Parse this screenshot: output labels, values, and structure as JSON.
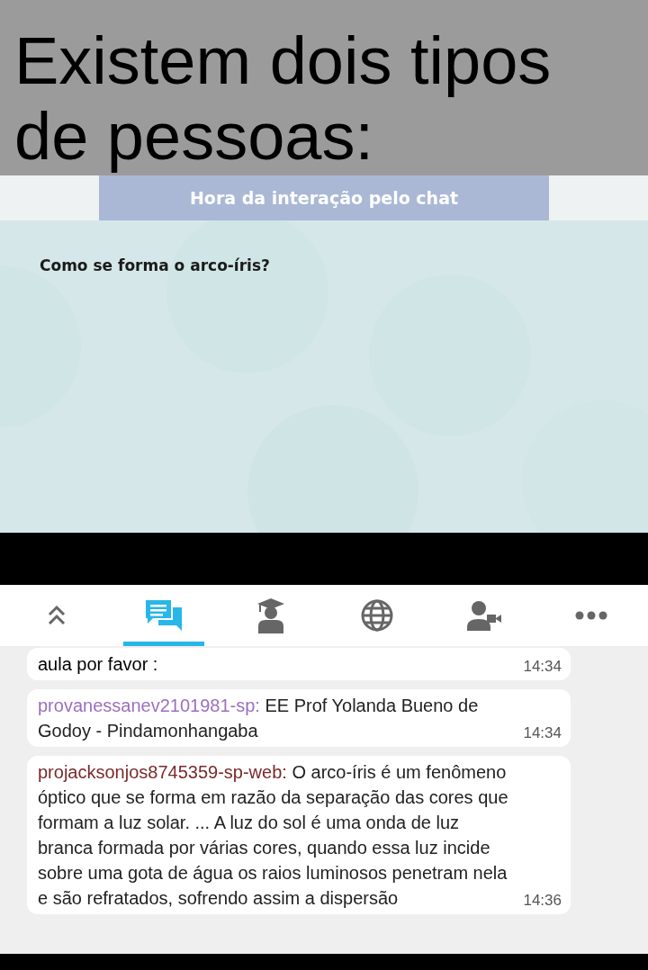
{
  "caption": "Existem dois tipos de pessoas:",
  "slide": {
    "header": "Hora da interação pelo chat",
    "question": "Como se forma o arco-íris?"
  },
  "tabs": [
    {
      "kind": "collapse",
      "selected": false
    },
    {
      "kind": "chat",
      "selected": true
    },
    {
      "kind": "teacher",
      "selected": false
    },
    {
      "kind": "globe",
      "selected": false
    },
    {
      "kind": "video-user",
      "selected": false
    },
    {
      "kind": "more",
      "selected": false
    }
  ],
  "messages": [
    {
      "color": "#000000",
      "text": "aula por favor :",
      "time": "14:34"
    },
    {
      "sender": "provanessanev2101981-sp:",
      "color": "#9b6fc0",
      "text": "EE Prof Yolanda Bueno de Godoy - Pindamonhangaba",
      "time": "14:34"
    },
    {
      "sender": "projacksonjos8745359-sp-web:",
      "color": "#7a2a2a",
      "text": "O arco-íris é um fenômeno óptico que se forma em razão da separação das cores que formam a luz solar. ... A luz do sol é uma onda de luz branca formada por várias cores, quando essa luz incide sobre uma gota de água os raios luminosos penetram nela e são refratados, sofrendo assim a dispersão",
      "time": "14:36"
    }
  ]
}
